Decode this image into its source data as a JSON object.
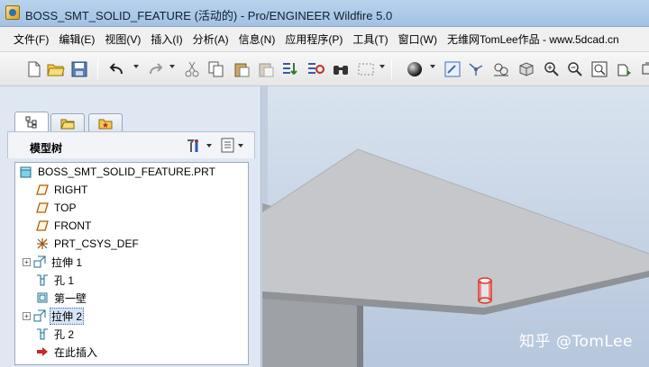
{
  "window": {
    "title": "BOSS_SMT_SOLID_FEATURE (活动的) - Pro/ENGINEER Wildfire 5.0"
  },
  "menu": [
    "文件(F)",
    "编辑(E)",
    "视图(V)",
    "插入(I)",
    "分析(A)",
    "信息(N)",
    "应用程序(P)",
    "工具(T)",
    "窗口(W)",
    "无维网TomLee作品 - www.5dcad.cn"
  ],
  "toolbar": {
    "icons": [
      "new-file",
      "open-folder",
      "save",
      "undo",
      "redo",
      "cut",
      "copy",
      "paste",
      "paste-special",
      "regenerate",
      "regenerate-manager",
      "find",
      "select-box",
      "shading",
      "repaint",
      "spin-center",
      "orient",
      "saved-views",
      "zoom-in",
      "zoom-out",
      "refit",
      "next-view"
    ]
  },
  "panel": {
    "tree_title": "模型树",
    "tabs": [
      "model-tree",
      "folder-browser",
      "favorites"
    ]
  },
  "tree": {
    "items": [
      {
        "label": "BOSS_SMT_SOLID_FEATURE.PRT",
        "icon": "part-icon",
        "expandable": false,
        "selected": false
      },
      {
        "label": "RIGHT",
        "icon": "datum-plane-icon",
        "expandable": false,
        "selected": false
      },
      {
        "label": "TOP",
        "icon": "datum-plane-icon",
        "expandable": false,
        "selected": false
      },
      {
        "label": "FRONT",
        "icon": "datum-plane-icon",
        "expandable": false,
        "selected": false
      },
      {
        "label": "PRT_CSYS_DEF",
        "icon": "csys-icon",
        "expandable": false,
        "selected": false
      },
      {
        "label": "拉伸 1",
        "icon": "extrude-icon",
        "expandable": true,
        "selected": false
      },
      {
        "label": "孔 1",
        "icon": "hole-icon",
        "expandable": false,
        "selected": false
      },
      {
        "label": "第一壁",
        "icon": "first-wall-icon",
        "expandable": false,
        "selected": false
      },
      {
        "label": "拉伸 2",
        "icon": "extrude-icon",
        "expandable": true,
        "selected": true
      },
      {
        "label": "孔 2",
        "icon": "hole-icon",
        "expandable": false,
        "selected": false
      },
      {
        "label": "在此插入",
        "icon": "insert-here-icon",
        "expandable": false,
        "selected": false
      }
    ]
  },
  "watermark": "知乎 @TomLee",
  "colors": {
    "titlebar": "#a3c1e3",
    "selection": "#d6e4f7",
    "model_plate": "#c7c9cc",
    "boss_red": "#e0342e"
  }
}
